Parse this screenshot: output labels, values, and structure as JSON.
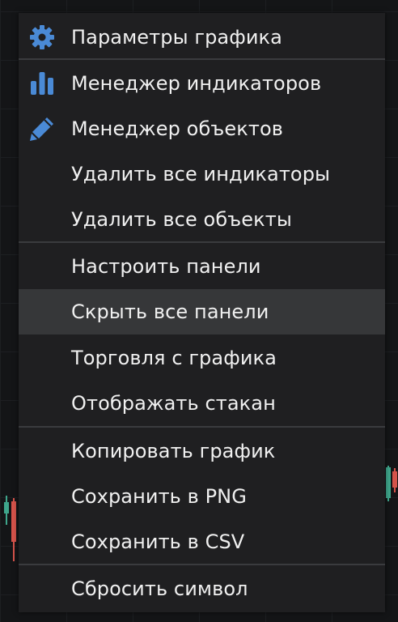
{
  "menu": {
    "items": [
      {
        "label": "Параметры графика",
        "icon": "gear-icon"
      },
      {
        "label": "Менеджер индикаторов",
        "icon": "bar-chart-icon"
      },
      {
        "label": "Менеджер объектов",
        "icon": "pencil-icon"
      },
      {
        "label": "Удалить все индикаторы"
      },
      {
        "label": "Удалить все объекты"
      },
      {
        "label": "Настроить панели"
      },
      {
        "label": "Скрыть все панели",
        "state": "hovered"
      },
      {
        "label": "Торговля с графика"
      },
      {
        "label": "Отображать стакан"
      },
      {
        "label": "Копировать график"
      },
      {
        "label": "Сохранить в PNG"
      },
      {
        "label": "Сохранить в CSV"
      },
      {
        "label": "Сбросить символ"
      }
    ]
  },
  "colors": {
    "menu_background": "#1f1f21",
    "hover_background": "#363739",
    "text": "#f0f0f0",
    "icon_accent": "#4a8ad6",
    "divider": "#3a3b3e",
    "candle_up": "#3fa68c",
    "candle_down": "#d4534a"
  }
}
